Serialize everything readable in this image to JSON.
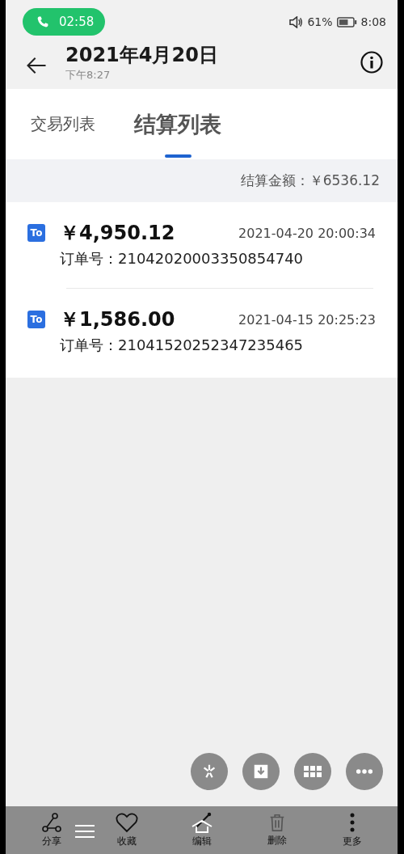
{
  "status_bar": {
    "call_time": "02:58",
    "battery": "61%",
    "clock": "8:08"
  },
  "header": {
    "title": "2021年4月20日",
    "subtitle": "下午8:27"
  },
  "tabs": [
    {
      "label": "交易列表",
      "selected": false
    },
    {
      "label": "结算列表",
      "selected": true
    }
  ],
  "summary": "结算金额：￥6536.12",
  "transactions": [
    {
      "badge": "To",
      "amount": "￥4,950.12",
      "datetime": "2021-04-20 20:00:34",
      "order": "订单号：21042020003350854740"
    },
    {
      "badge": "To",
      "amount": "￥1,586.00",
      "datetime": "2021-04-15 20:25:23",
      "order": "订单号：21041520252347235465"
    }
  ],
  "toolbar": [
    {
      "label": "分享"
    },
    {
      "label": "收藏"
    },
    {
      "label": "编辑"
    },
    {
      "label": "删除"
    },
    {
      "label": "更多"
    }
  ]
}
